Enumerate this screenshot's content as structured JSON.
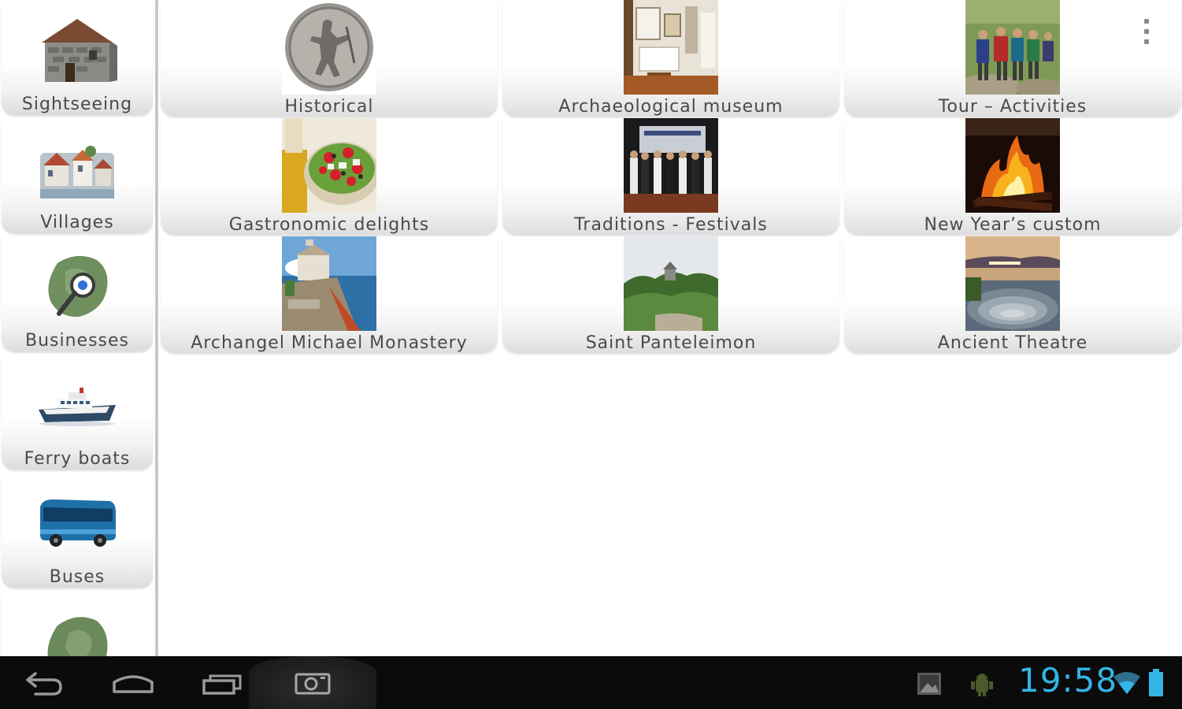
{
  "sidebar": {
    "items": [
      {
        "label": "Sightseeing",
        "icon": "stone-house-icon"
      },
      {
        "label": "Villages",
        "icon": "village-icon"
      },
      {
        "label": "Businesses",
        "icon": "map-magnifier-icon"
      },
      {
        "label": "Ferry boats",
        "icon": "ferry-icon"
      },
      {
        "label": "Buses",
        "icon": "bus-icon"
      },
      {
        "label": "",
        "icon": "island-map-icon"
      }
    ]
  },
  "grid": {
    "tiles": [
      {
        "label": "Historical",
        "thumb": "coin"
      },
      {
        "label": "Archaeological museum",
        "thumb": "museum"
      },
      {
        "label": "Tour – Activities",
        "thumb": "hikers"
      },
      {
        "label": "Gastronomic delights",
        "thumb": "salad"
      },
      {
        "label": "Traditions - Festivals",
        "thumb": "festival"
      },
      {
        "label": "New Year’s custom",
        "thumb": "fire"
      },
      {
        "label": "Archangel Michael Monastery",
        "thumb": "monastery"
      },
      {
        "label": "Saint Panteleimon",
        "thumb": "forest"
      },
      {
        "label": "Ancient Theatre",
        "thumb": "theatre"
      }
    ]
  },
  "menu": {
    "icon": "overflow-menu-icon"
  },
  "system_bar": {
    "clock": "19:58",
    "clock_color": "#33b5e5",
    "nav": [
      "back-icon",
      "home-icon",
      "recent-apps-icon",
      "screenshot-icon"
    ],
    "status_icons": [
      "gallery-notification-icon",
      "android-debug-icon",
      "wifi-icon",
      "battery-icon"
    ]
  }
}
